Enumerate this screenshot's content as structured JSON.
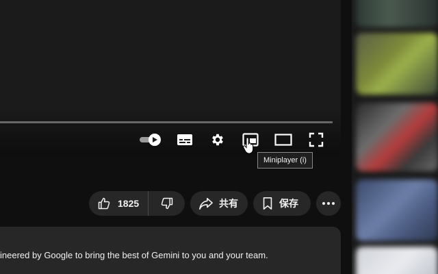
{
  "player": {
    "tooltip": "Miniplayer (i)",
    "controls": {
      "autoplay_icon": "autoplay-toggle-icon",
      "subtitles_icon": "subtitles-icon",
      "settings_icon": "gear-icon",
      "miniplayer_icon": "miniplayer-icon",
      "theater_icon": "theater-mode-icon",
      "fullscreen_icon": "fullscreen-icon"
    }
  },
  "actions": {
    "like_count": "1825",
    "like_icon": "thumbs-up-icon",
    "dislike_icon": "thumbs-down-icon",
    "share_label": "共有",
    "share_icon": "share-icon",
    "save_label": "保存",
    "save_icon": "bookmark-icon",
    "more_icon": "more-horizontal-icon"
  },
  "description": {
    "text": "ineered by Google to bring the best of Gemini to you and your team."
  },
  "colors": {
    "background": "#0f0f0f",
    "pill": "#272727",
    "text": "#f1f1f1"
  }
}
